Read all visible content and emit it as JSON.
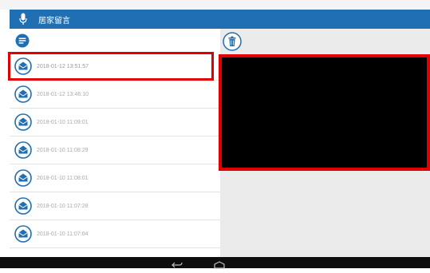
{
  "app": {
    "title": "居家留言"
  },
  "messages": [
    {
      "timestamp": "2018-01-12 13:51:57",
      "selected": true
    },
    {
      "timestamp": "2018-01-12 13:46:10"
    },
    {
      "timestamp": "2018-01-10 11:09:01"
    },
    {
      "timestamp": "2018-01-10 11:08:29"
    },
    {
      "timestamp": "2018-01-10 11:08:01"
    },
    {
      "timestamp": "2018-01-10 11:07:28"
    },
    {
      "timestamp": "2018-01-10 11:07:04"
    }
  ],
  "colors": {
    "titlebar": "#1f6fb2",
    "icon": "#1f6fb2",
    "highlight": "#e00000",
    "navbar": "#0d0d0d"
  },
  "icons": [
    "microphone-icon",
    "chat-bubble-icon",
    "trash-icon",
    "envelope-icon",
    "back-icon",
    "home-icon"
  ]
}
